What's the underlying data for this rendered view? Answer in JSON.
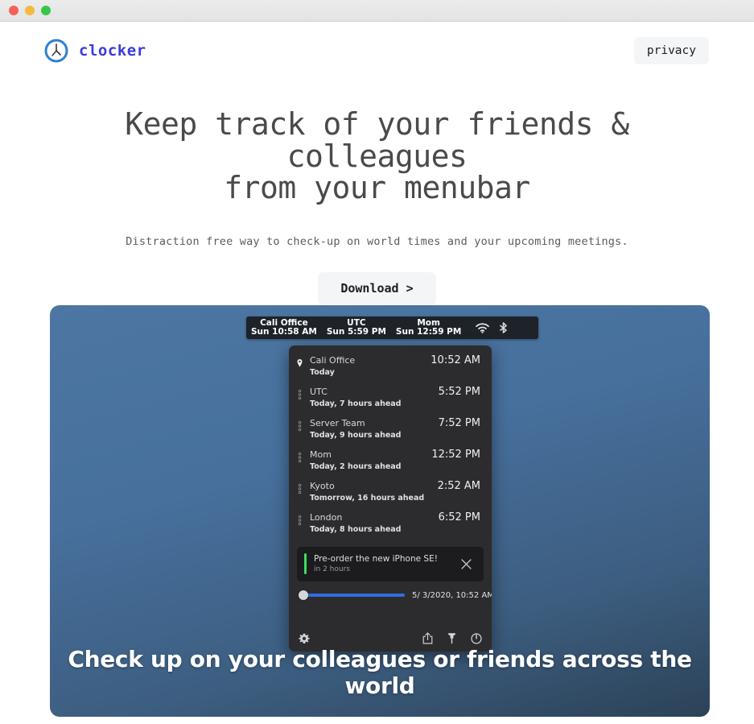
{
  "window": {
    "controls": [
      {
        "name": "close",
        "color": "#f4615a"
      },
      {
        "name": "minimize",
        "color": "#f6b93d"
      },
      {
        "name": "zoom",
        "color": "#35c847"
      }
    ]
  },
  "header": {
    "brand_name": "clocker",
    "brand_color": "#3b3bdb",
    "logo_icon": "clock-icon",
    "privacy_label": "privacy"
  },
  "hero": {
    "headline_line1": "Keep track of your friends & colleagues",
    "headline_line2": "from your menubar",
    "subtitle": "Distraction free way to check-up on world times and your upcoming meetings.",
    "download_label": "Download >"
  },
  "showcase": {
    "caption": "Check up on your colleagues or friends across the world",
    "background_top": "#4d76a2",
    "background_bottom": "#2c4257",
    "menubar": {
      "clocks": [
        {
          "name": "Cali Office",
          "time": "Sun 10:58 AM"
        },
        {
          "name": "UTC",
          "time": "Sun 5:59 PM"
        },
        {
          "name": "Mom",
          "time": "Sun 12:59 PM"
        }
      ],
      "icons": [
        "wifi-icon",
        "bluetooth-icon"
      ]
    },
    "panel": {
      "timezones": [
        {
          "icon": "location-pin-icon",
          "name": "Cali Office",
          "time": "10:52 AM",
          "relative": "Today"
        },
        {
          "icon": "drag-handle-icon",
          "name": "UTC",
          "time": "5:52 PM",
          "relative": "Today, 7 hours ahead"
        },
        {
          "icon": "drag-handle-icon",
          "name": "Server Team",
          "time": "7:52 PM",
          "relative": "Today, 9 hours ahead"
        },
        {
          "icon": "drag-handle-icon",
          "name": "Mom",
          "time": "12:52 PM",
          "relative": "Today, 2 hours ahead"
        },
        {
          "icon": "drag-handle-icon",
          "name": "Kyoto",
          "time": "2:52 AM",
          "relative": "Tomorrow, 16 hours ahead"
        },
        {
          "icon": "drag-handle-icon",
          "name": "London",
          "time": "6:52 PM",
          "relative": "Today, 8 hours ahead"
        }
      ],
      "event": {
        "title": "Pre-order the new iPhone SE!",
        "subtitle": "in 2 hours",
        "accent_color": "#3ddc60",
        "close_icon": "close-icon"
      },
      "slider": {
        "value_percent": 0,
        "date_label": "5/ 3/2020, 10:52 AM",
        "track_color": "#2e6fe0"
      },
      "toolbar": {
        "settings_icon": "gear-icon",
        "share_icon": "share-icon",
        "pin_icon": "pin-icon",
        "power_icon": "power-icon"
      }
    }
  }
}
